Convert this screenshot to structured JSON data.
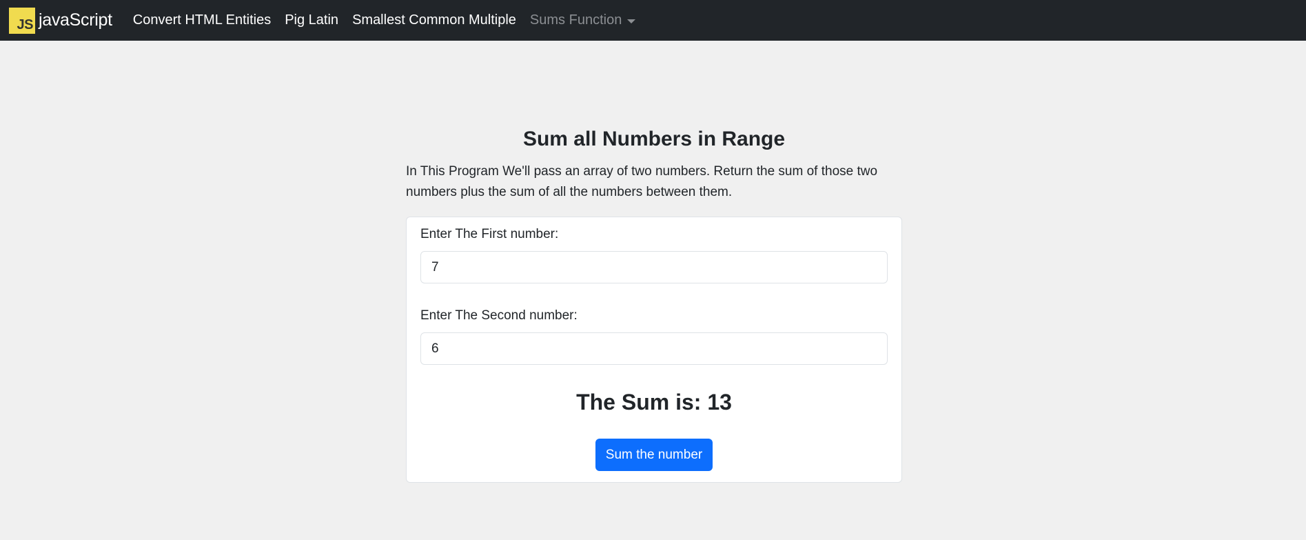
{
  "navbar": {
    "logo_text": "JS",
    "brand": "javaScript",
    "links": [
      {
        "label": "Convert HTML Entities"
      },
      {
        "label": "Pig Latin"
      },
      {
        "label": "Smallest Common Multiple"
      },
      {
        "label": "Sums Function"
      }
    ],
    "colors": {
      "background": "#212529",
      "logo_background": "#f0db4f",
      "active_link": "#ffffff",
      "dropdown_link": "#8c8f93"
    }
  },
  "main": {
    "title": "Sum all Numbers in Range",
    "description": "In This Program We'll pass an array of two numbers. Return the sum of those two numbers plus the sum of all the numbers between them.",
    "form": {
      "first_label": "Enter The First number:",
      "first_value": "7",
      "second_label": "Enter The Second number:",
      "second_value": "6",
      "result_text": "The Sum is: 13",
      "button_label": "Sum the number"
    },
    "colors": {
      "page_background": "#f0f0f0",
      "card_background": "#ffffff",
      "button": "#0d6efd"
    }
  },
  "icons": {
    "dropdown": "caret-down-icon",
    "logo": "js-logo-icon"
  }
}
